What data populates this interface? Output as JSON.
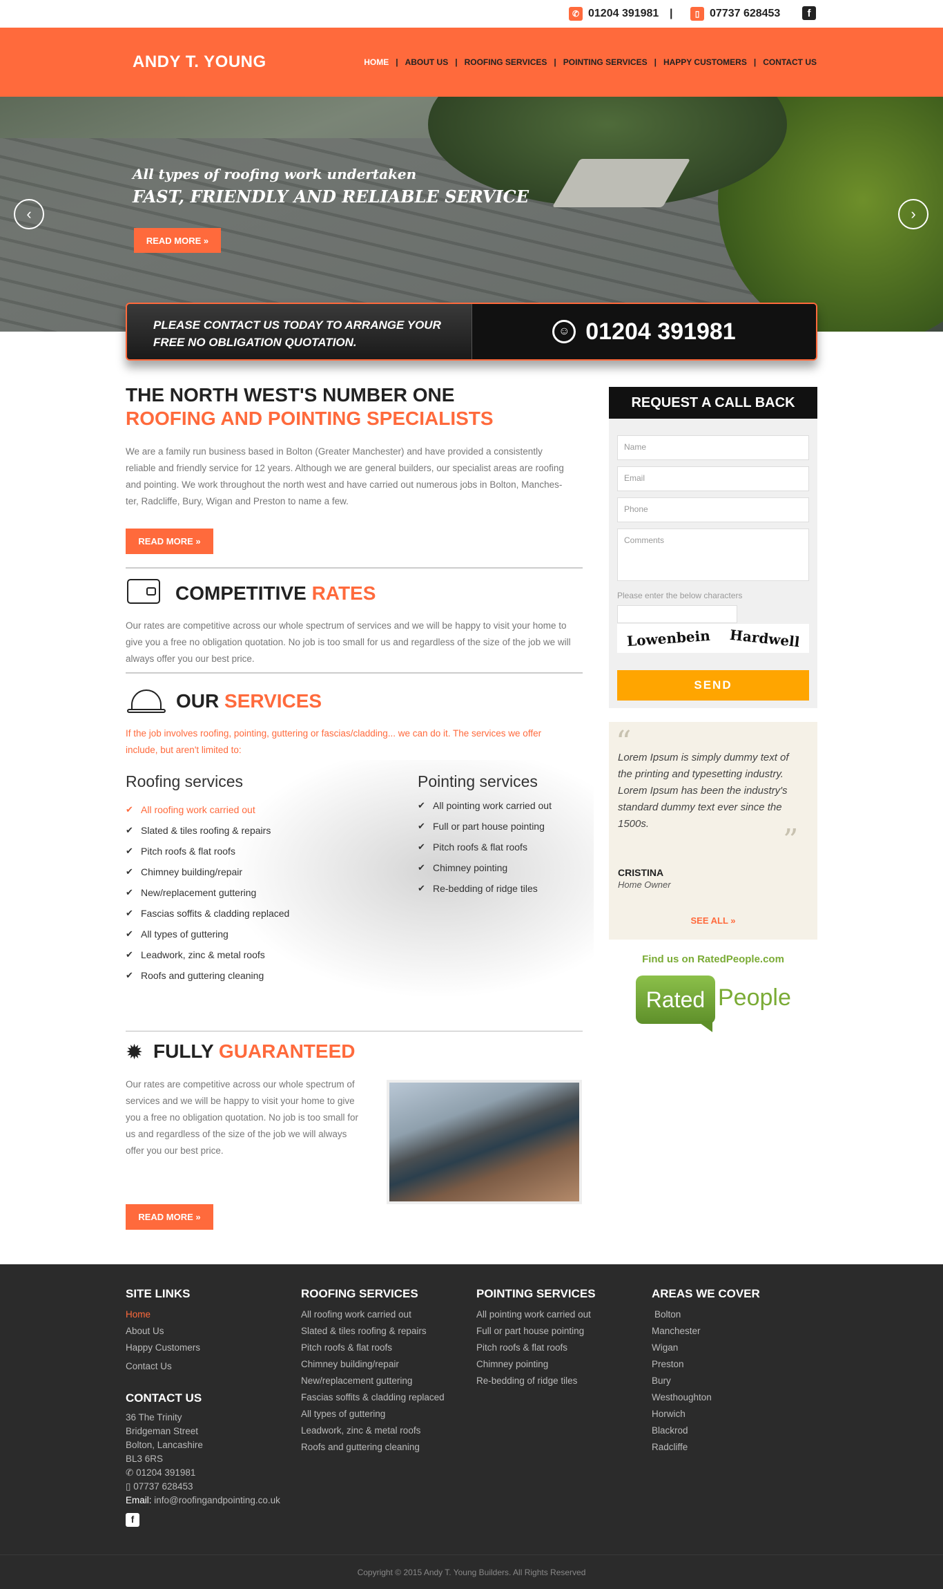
{
  "topbar": {
    "phone1": "01204 391981",
    "separator": "|",
    "phone2": "07737 628453",
    "phone_icon": "phone-icon",
    "mobile_icon": "mobile-icon",
    "social_icon": "facebook-icon"
  },
  "header": {
    "logo": "ANDY T. YOUNG",
    "nav": [
      {
        "label": "HOME"
      },
      {
        "label": "ABOUT US"
      },
      {
        "label": "ROOFING SERVICES"
      },
      {
        "label": "POINTING SERVICES"
      },
      {
        "label": "HAPPY CUSTOMERS"
      },
      {
        "label": "CONTACT US"
      }
    ],
    "nav_separator": "|"
  },
  "hero": {
    "line1": "All types of roofing work undertaken",
    "line2": "FAST, FRIENDLY AND RELIABLE SERVICE",
    "button": "READ MORE",
    "prev_icon": "chevron-left-icon",
    "next_icon": "chevron-right-icon"
  },
  "cta": {
    "text_line1": "PLEASE CONTACT US TODAY TO ARRANGE YOUR",
    "text_line2": "FREE NO OBLIGATION QUOTATION.",
    "phone": "01204 391981",
    "icon": "headset-icon"
  },
  "intro": {
    "title_line1": "THE NORTH WEST'S NUMBER ONE",
    "title_line2": "ROOFING AND POINTING SPECIALISTS",
    "paragraph_lines": [
      "We are a family run business based in Bolton (Greater Manchester) and have provided a consistently",
      "reliable and friendly service for 12 years. Although we are general builders, our specialist areas are roofing",
      "and pointing. We work throughout the north west and have carried out numerous jobs in Bolton, Manches-",
      "ter, Radcliffe, Bury, Wigan and Preston to name a few."
    ],
    "button": "READ MORE"
  },
  "rates": {
    "title_a": "COMPETITIVE",
    "title_b": "RATES",
    "icon": "wallet-icon",
    "paragraph_lines": [
      "Our rates are competitive across our whole spectrum of services and we will be happy to visit your home to",
      "give you a free no obligation quotation. No job is too small for us and regardless of the size of the job we will",
      "always offer you our best price."
    ]
  },
  "services": {
    "title_a": "OUR",
    "title_b": "SERVICES",
    "icon": "hard-hat-icon",
    "lead_lines": [
      "If the job involves roofing, pointing, guttering or fascias/cladding... we can do it. The services we offer",
      "include, but aren't limited to:"
    ],
    "roofing_heading": "Roofing services",
    "roofing": [
      "All roofing work carried out",
      "Slated & tiles roofing & repairs",
      "Pitch roofs & flat roofs",
      "Chimney building/repair",
      "New/replacement guttering",
      "Fascias soffits & cladding replaced",
      "All types of guttering",
      "Leadwork, zinc & metal roofs",
      "Roofs and guttering cleaning"
    ],
    "pointing_heading": "Pointing services",
    "pointing": [
      "All pointing work carried out",
      "Full or part house pointing",
      "Pitch roofs & flat roofs",
      "Chimney pointing",
      "Re-bedding of ridge tiles"
    ],
    "check_icon": "check-icon"
  },
  "guarantee": {
    "title_a": "FULLY",
    "title_b": "GUARANTEED",
    "icon": "seal-icon",
    "paragraph_lines": [
      "Our rates are competitive across our whole spectrum of",
      "services and we will be happy to visit your home to give",
      "you a free no obligation quotation. No job is too small for",
      "us and regardless of the size of the job we will always",
      "offer you our best price."
    ],
    "button": "READ MORE"
  },
  "form": {
    "title": "REQUEST A CALL BACK",
    "name_placeholder": "Name",
    "email_placeholder": "Email",
    "phone_placeholder": "Phone",
    "comments_placeholder": "Comments",
    "captcha_label": "Please enter the below characters",
    "captcha_word1": "Lowenbein",
    "captcha_word2": "Hardwell",
    "send": "SEND"
  },
  "testimonial": {
    "quote_lines": [
      "Lorem Ipsum is simply dummy text of",
      "the printing and typesetting industry.",
      "Lorem Ipsum has been the industry's",
      "standard dummy text ever since the",
      "1500s."
    ],
    "name": "CRISTINA",
    "role": "Home Owner",
    "see_all": "SEE ALL",
    "open_quote_icon": "quote-open-icon",
    "close_quote_icon": "quote-close-icon"
  },
  "rated": {
    "find_prefix": "Find us on",
    "find_link": "RatedPeople.com",
    "logo_word1": "Rated",
    "logo_word2": "People"
  },
  "footer": {
    "site_links_title": "SITE LINKS",
    "site_links": [
      "Home",
      "About Us",
      "Happy Customers",
      "Contact Us"
    ],
    "contact_title": "CONTACT US",
    "address": [
      "36 The Trinity",
      "Bridgeman Street",
      "Bolton, Lancashire",
      "BL3 6RS"
    ],
    "phone": "01204 391981",
    "mobile": "07737 628453",
    "email_label": "Email:",
    "email": "info@roofingandpointing.co.uk",
    "roofing_title": "ROOFING SERVICES",
    "roofing": [
      "All roofing work carried out",
      "Slated & tiles roofing & repairs",
      "Pitch roofs & flat roofs",
      "Chimney building/repair",
      "New/replacement guttering",
      "Fascias soffits & cladding replaced",
      "All types of guttering",
      "Leadwork, zinc & metal roofs",
      "Roofs and guttering cleaning"
    ],
    "pointing_title": "POINTING SERVICES",
    "pointing": [
      "All pointing work carried out",
      "Full or part house pointing",
      "Pitch roofs & flat roofs",
      "Chimney pointing",
      "Re-bedding of ridge tiles"
    ],
    "areas_title": "AREAS WE COVER",
    "areas": [
      "Bolton",
      "Manchester",
      "Wigan",
      "Preston",
      "Bury",
      "Westhoughton",
      "Horwich",
      "Blackrod",
      "Radcliffe"
    ],
    "copyright": "Copyright © 2015 Andy T. Young Builders. All Rights Reserved"
  },
  "colors": {
    "accent": "#ff6a3c",
    "dark": "#111111",
    "footer": "#2b2b2b",
    "send": "#ffa500",
    "rated_green": "#7aab35"
  }
}
